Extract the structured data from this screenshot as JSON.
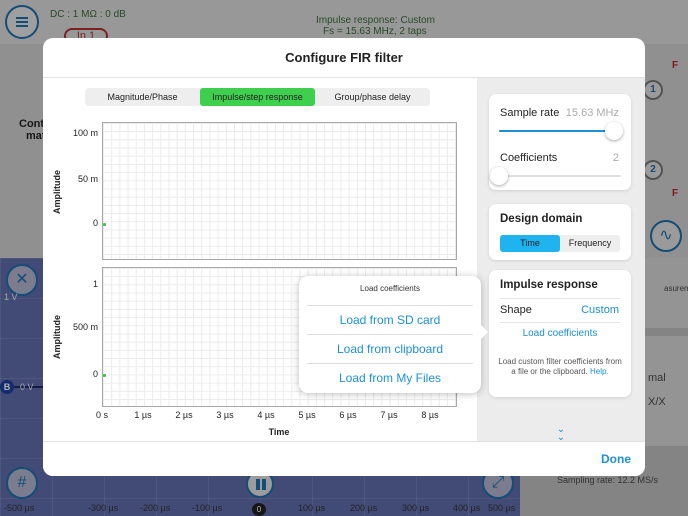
{
  "background": {
    "channel_info": "DC : 1 MΩ : 0 dB",
    "input_badge": "In 1",
    "impulse_title": "Impulse response: Custom",
    "impulse_details": "Fs = 15.63 MHz, 2 taps",
    "left_partial_1": "Cont",
    "left_partial_2": "mat",
    "channel2_badge": "2",
    "channel1_badge": "1",
    "red_f_1": "F",
    "red_f_2": "F",
    "measurements_partial": "asurements",
    "partial_mal": "mal",
    "partial_xx": "X/X",
    "scope_y_label": "1 V",
    "scope_b_marker": "B",
    "scope_b_value": "0 V",
    "sampling_rate": "Sampling rate: 12.2 MS/s",
    "zero_marker": "0",
    "x_ticks": [
      "-500 µs",
      "-300 µs",
      "-200 µs",
      "-100 µs",
      "100 µs",
      "200 µs",
      "300 µs",
      "400 µs",
      "500 µs"
    ]
  },
  "modal": {
    "title": "Configure FIR filter",
    "done_label": "Done",
    "tabs": [
      {
        "label": "Magnitude/Phase",
        "active": false
      },
      {
        "label": "Impulse/step response",
        "active": true
      },
      {
        "label": "Group/phase delay",
        "active": false
      }
    ],
    "plot_top": {
      "y_label": "Amplitude",
      "y_ticks": [
        "100 m",
        "50 m",
        "0"
      ]
    },
    "plot_bottom": {
      "y_label": "Amplitude",
      "y_ticks": [
        "1",
        "500 m",
        "0"
      ]
    },
    "x_label": "Time",
    "x_ticks": [
      "0 s",
      "1 µs",
      "2 µs",
      "3 µs",
      "4 µs",
      "5 µs",
      "6 µs",
      "7 µs",
      "8 µs"
    ],
    "popover": {
      "title": "Load coefficients",
      "items": [
        "Load from SD card",
        "Load from clipboard",
        "Load from My Files"
      ]
    },
    "settings": {
      "sample_rate_label": "Sample rate",
      "sample_rate_value": "15.63 MHz",
      "sample_rate_slider": 0.94,
      "coefficients_label": "Coefficients",
      "coefficients_value": "2",
      "coefficients_slider": 0.0
    },
    "design_domain": {
      "title": "Design domain",
      "options": [
        {
          "label": "Time",
          "active": true
        },
        {
          "label": "Frequency",
          "active": false
        }
      ]
    },
    "impulse_response": {
      "title": "Impulse response",
      "shape_label": "Shape",
      "shape_value": "Custom",
      "load_button": "Load coefficients",
      "help_text": "Load custom filter coefficients from a file or the clipboard.",
      "help_link": "Help."
    }
  },
  "colors": {
    "accent_blue": "#1e8fd6",
    "active_green": "#3fcf4f",
    "active_cyan": "#1fb3f0",
    "trace_green": "#2ecc40"
  }
}
